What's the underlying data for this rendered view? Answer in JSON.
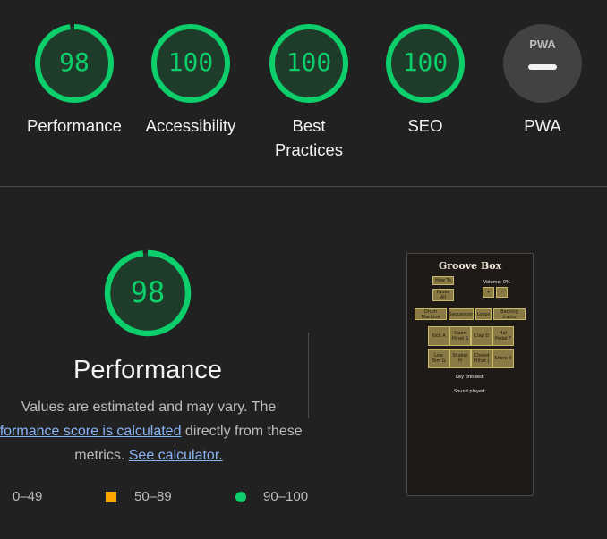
{
  "scores": [
    {
      "value": "98",
      "label": "Performance"
    },
    {
      "value": "100",
      "label": "Accessibility"
    },
    {
      "value": "100",
      "label": "Best Practices"
    },
    {
      "value": "100",
      "label": "SEO"
    }
  ],
  "pwa": {
    "label": "PWA",
    "badge": "PWA",
    "icon": "pwa-dash-icon"
  },
  "detail": {
    "score": "98",
    "title": "Performance",
    "desc_line1": "Values are estimated and may vary. The",
    "desc_link1": "rformance score is calculated",
    "desc_line2_rest": " directly from these",
    "desc_line3_pre": "metrics. ",
    "desc_link2": "See calculator."
  },
  "legend": {
    "fail": "0–49",
    "average": "50–89",
    "pass": "90–100"
  },
  "colors": {
    "pass": "#0cce6b",
    "average": "#ffa400",
    "fail": "#ff4e42",
    "link": "#8ab4f8"
  },
  "screenshot": {
    "title": "Groove Box",
    "how_to": "How To",
    "pause_all": "Pause All",
    "volume": "Volume: 0%",
    "vol_up": "+",
    "vol_down": "-",
    "modes": [
      "Drum Machine",
      "Sequencer",
      "Loops",
      "Backing tracks"
    ],
    "pads": [
      "Kick A",
      "Open Hihat S",
      "Clap D",
      "Hat Pedal F",
      "Low Tom G",
      "Shaker H",
      "Closed Hihat J",
      "Snare K"
    ],
    "key_pressed": "Key pressed:",
    "sound_played": "Sound played:"
  }
}
